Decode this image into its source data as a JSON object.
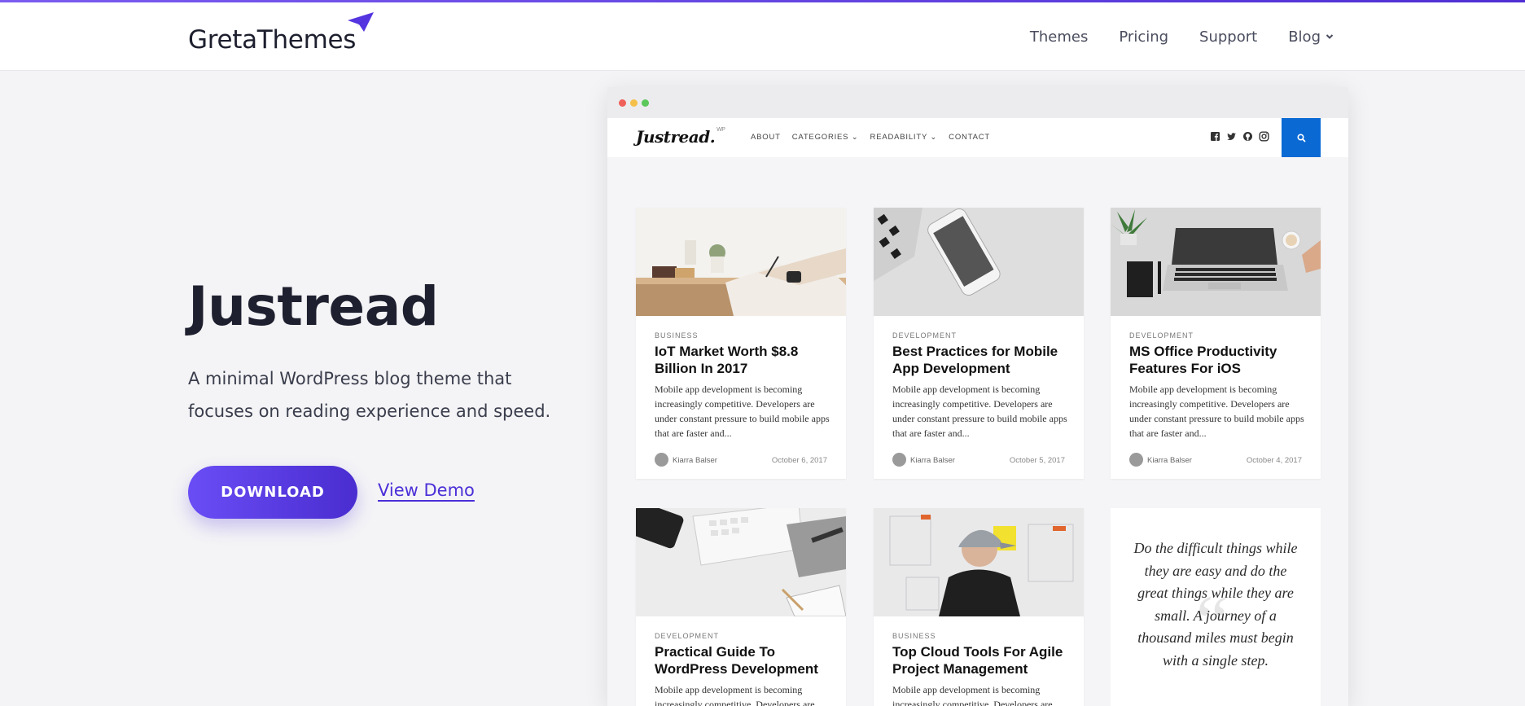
{
  "brand": {
    "name": "GretaThemes"
  },
  "nav": {
    "items": [
      {
        "label": "Themes"
      },
      {
        "label": "Pricing"
      },
      {
        "label": "Support"
      },
      {
        "label": "Blog"
      }
    ]
  },
  "hero": {
    "title": "Justread",
    "description": "A minimal WordPress blog theme that focuses on reading experience and speed.",
    "download_label": "DOWNLOAD",
    "demo_label": "View Demo"
  },
  "colors": {
    "accent": "#5b3ee6",
    "demo_link": "#4b2fd8",
    "mock_search": "#0b69d4"
  },
  "mockup": {
    "logo": "Justread.",
    "logo_suffix": "WP",
    "menu": [
      "ABOUT",
      "CATEGORIES",
      "READABILITY",
      "CONTACT"
    ],
    "social_icons": [
      "facebook-icon",
      "twitter-icon",
      "github-icon",
      "instagram-icon"
    ],
    "posts": [
      {
        "category": "BUSINESS",
        "title": "IoT Market Worth $8.8 Billion In 2017",
        "excerpt": "Mobile app development is becoming increasingly competitive. Developers are under constant pressure to build mobile apps that are faster and...",
        "author": "Kiarra Balser",
        "date": "October 6, 2017"
      },
      {
        "category": "DEVELOPMENT",
        "title": "Best Practices for Mobile App Development",
        "excerpt": "Mobile app development is becoming increasingly competitive. Developers are under constant pressure to build mobile apps that are faster and...",
        "author": "Kiarra Balser",
        "date": "October 5, 2017"
      },
      {
        "category": "DEVELOPMENT",
        "title": "MS Office Productivity Features For iOS",
        "excerpt": "Mobile app development is becoming increasingly competitive. Developers are under constant pressure to build mobile apps that are faster and...",
        "author": "Kiarra Balser",
        "date": "October 4, 2017"
      },
      {
        "category": "DEVELOPMENT",
        "title": "Practical Guide To WordPress Development",
        "excerpt": "Mobile app development is becoming increasingly competitive. Developers are under constant pressure to build mobile apps that are faster and..."
      },
      {
        "category": "BUSINESS",
        "title": "Top Cloud Tools For Agile Project Management",
        "excerpt": "Mobile app development is becoming increasingly competitive. Developers are under constant pressure to build mobile apps that are faster and..."
      }
    ],
    "quote": "Do the difficult things while they are easy and do the great things while they are small. A journey of a thousand miles must begin with a single step."
  }
}
